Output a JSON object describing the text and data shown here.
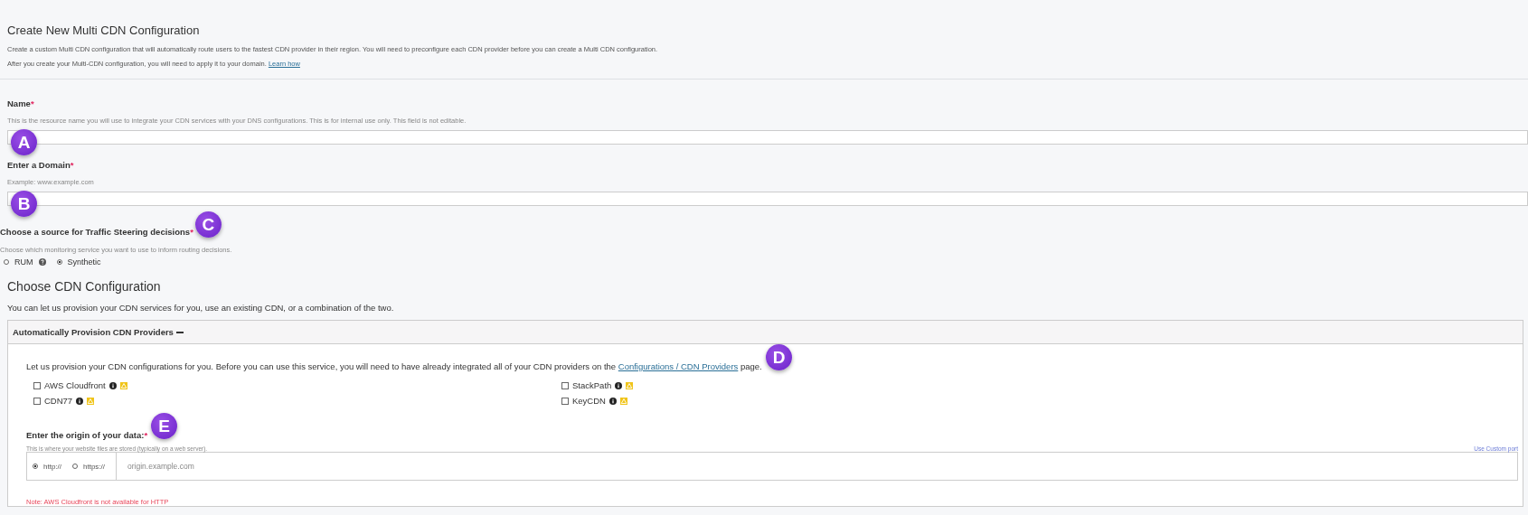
{
  "header": {
    "title": "Create New Multi CDN Configuration",
    "description": "Create a custom Multi CDN configuration that will automatically route users to the fastest CDN provider in their region. You will need to preconfigure each CDN provider before you can create a Multi CDN configuration.",
    "apply_text": "After you create your Multi-CDN configuration, you will need to apply it to your domain.",
    "apply_link": "Learn how"
  },
  "fields": [
    {
      "label": "Name",
      "required_mark": "*",
      "hint": "This is the resource name you will use to integrate your CDN services with your DNS configurations. This is for internal use only. This field is not editable.",
      "callout": "A"
    },
    {
      "label": "Enter a Domain",
      "required_mark": "*",
      "hint": "Example: www.example.com",
      "callout": "B"
    }
  ],
  "steering": {
    "label": "Choose a source for Traffic Steering decisions",
    "required_mark": "*",
    "hint": "Choose which monitoring service you want to use to inform routing decisions.",
    "callout": "C",
    "options": [
      {
        "label": "RUM",
        "selected": false,
        "help": true
      },
      {
        "label": "Synthetic",
        "selected": true,
        "help": false
      }
    ]
  },
  "cdn": {
    "title": "Choose CDN Configuration",
    "description": "You can let us provision your CDN services for you, use an existing CDN, or a combination of the two.",
    "panel": {
      "title": "Automatically Provision CDN Providers",
      "expanded": true,
      "intro_before": "Let us provision your CDN configurations for you. Before you can use this service, you will need to have already integrated all of your CDN providers on the",
      "intro_link": "Configurations / CDN Providers",
      "intro_after": "page.",
      "callout": "D",
      "providers": [
        {
          "label": "AWS Cloudfront",
          "checked": false
        },
        {
          "label": "StackPath",
          "checked": false
        },
        {
          "label": "CDN77",
          "checked": false
        },
        {
          "label": "KeyCDN",
          "checked": false
        }
      ],
      "origin": {
        "label": "Enter the origin of your data:",
        "required_mark": "*",
        "hint": "This is where your website files are stored (typically on a web server).",
        "callout": "E",
        "custom_port_link": "Use Custom port",
        "protocols": [
          {
            "label": "http://",
            "selected": true
          },
          {
            "label": "https://",
            "selected": false
          }
        ],
        "placeholder": "origin.example.com",
        "note": "Note: AWS Cloudfront is not available for HTTP"
      }
    }
  }
}
